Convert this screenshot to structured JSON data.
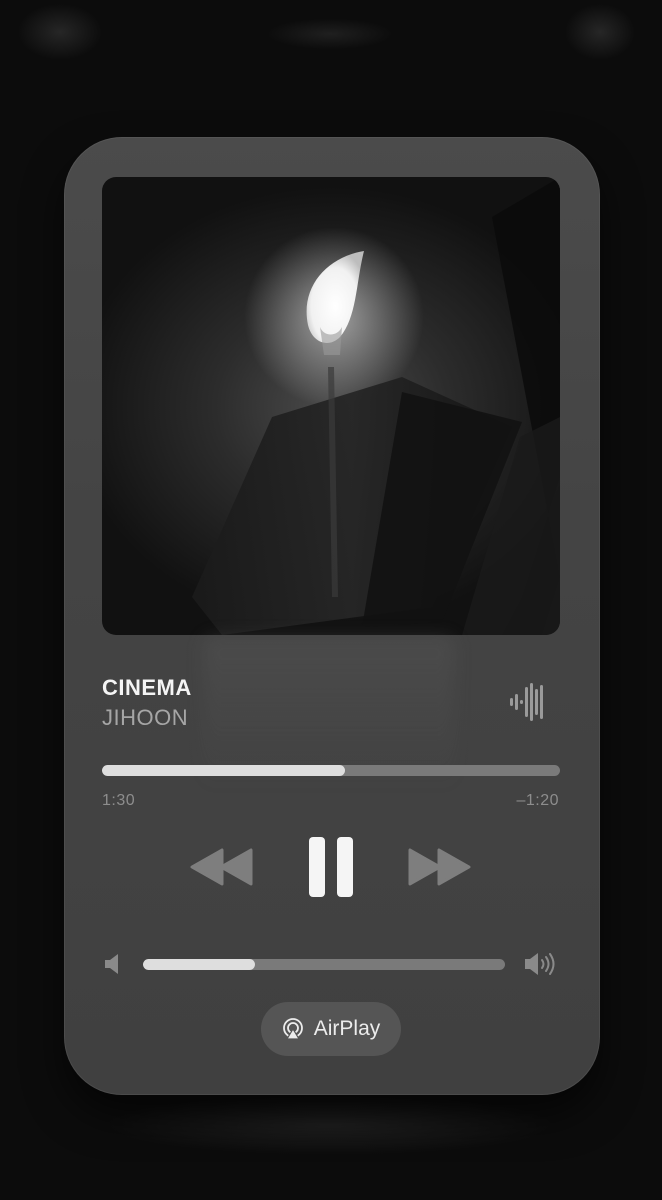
{
  "now_playing": {
    "title": "CINEMA",
    "artist": "JIHOON",
    "elapsed": "1:30",
    "remaining": "–1:20",
    "progress": 0.53,
    "volume": 0.31,
    "icons": [
      "waveform-icon",
      "rewind-icon",
      "pause-icon",
      "fast-forward-icon",
      "speaker-low-icon",
      "speaker-high-icon",
      "airplay-icon"
    ]
  },
  "airplay": {
    "label": "AirPlay"
  },
  "colors": {
    "card": "#454545",
    "track": "#7a7a7a",
    "fill": "#dedede",
    "title": "#f4f4f4",
    "secondary": "#a6a6a6"
  }
}
